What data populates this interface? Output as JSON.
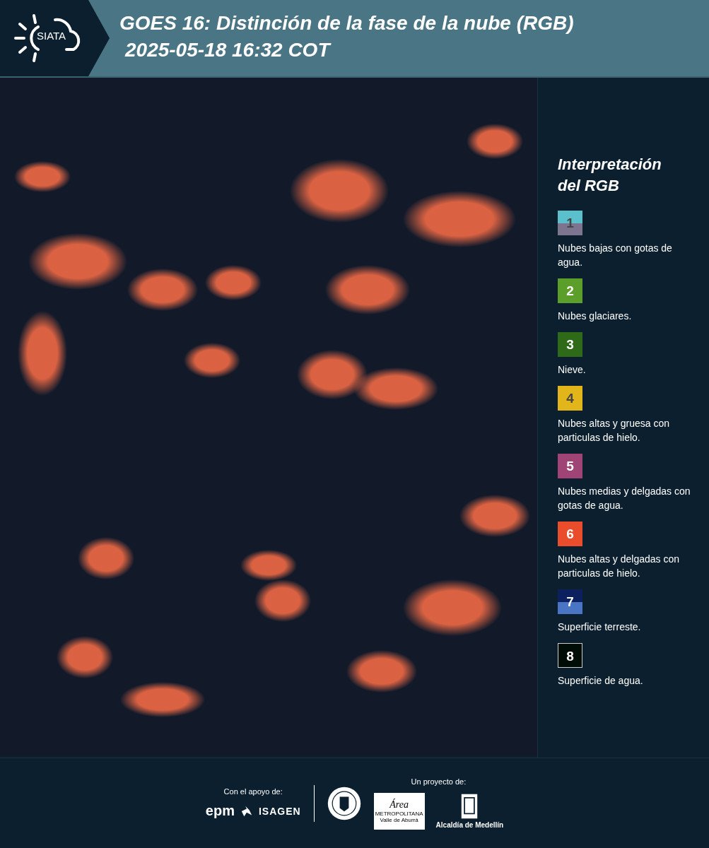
{
  "header": {
    "logo_text": "SIATA",
    "title": "GOES 16: Distinción de la fase de la nube (RGB)",
    "subtitle": "2025-05-18 16:32 COT"
  },
  "legend": {
    "title": "Interpretación del RGB",
    "items": [
      {
        "number": "1",
        "bands": [
          {
            "color": "#5bbfcc"
          },
          {
            "color": "#7d7590"
          }
        ],
        "number_dark": true,
        "label": "Nubes bajas con gotas de agua."
      },
      {
        "number": "2",
        "bands": [
          {
            "color": "#5c9e2a"
          }
        ],
        "number_dark": false,
        "label": "Nubes glaciares."
      },
      {
        "number": "3",
        "bands": [
          {
            "color": "#2f6a18"
          }
        ],
        "number_dark": false,
        "label": "Nieve."
      },
      {
        "number": "4",
        "bands": [
          {
            "color": "#e2b51a"
          }
        ],
        "number_dark": true,
        "label": "Nubes altas y gruesa con particulas de hielo."
      },
      {
        "number": "5",
        "bands": [
          {
            "color": "#a04476"
          }
        ],
        "number_dark": false,
        "label": "Nubes medias y delgadas con gotas de agua."
      },
      {
        "number": "6",
        "bands": [
          {
            "color": "#ea4d2b"
          }
        ],
        "number_dark": false,
        "label": "Nubes altas y delgadas con particulas de hielo."
      },
      {
        "number": "7",
        "bands": [
          {
            "color": "#0c1f5e"
          },
          {
            "color": "#4a74c4"
          }
        ],
        "number_dark": false,
        "label": "Superficie terreste."
      },
      {
        "number": "8",
        "bands": [
          {
            "color": "#000c06"
          }
        ],
        "number_dark": false,
        "label": "Superficie de agua."
      }
    ]
  },
  "footer": {
    "support_label": "Con el apoyo de:",
    "support_logos": [
      "epm",
      "ISAGEN"
    ],
    "project_label": "Un proyecto de:",
    "area_logo": [
      "Área",
      "METROPOLITANA",
      "Valle de Aburrá"
    ],
    "alcaldia_label": "Alcaldía de Medellín"
  }
}
